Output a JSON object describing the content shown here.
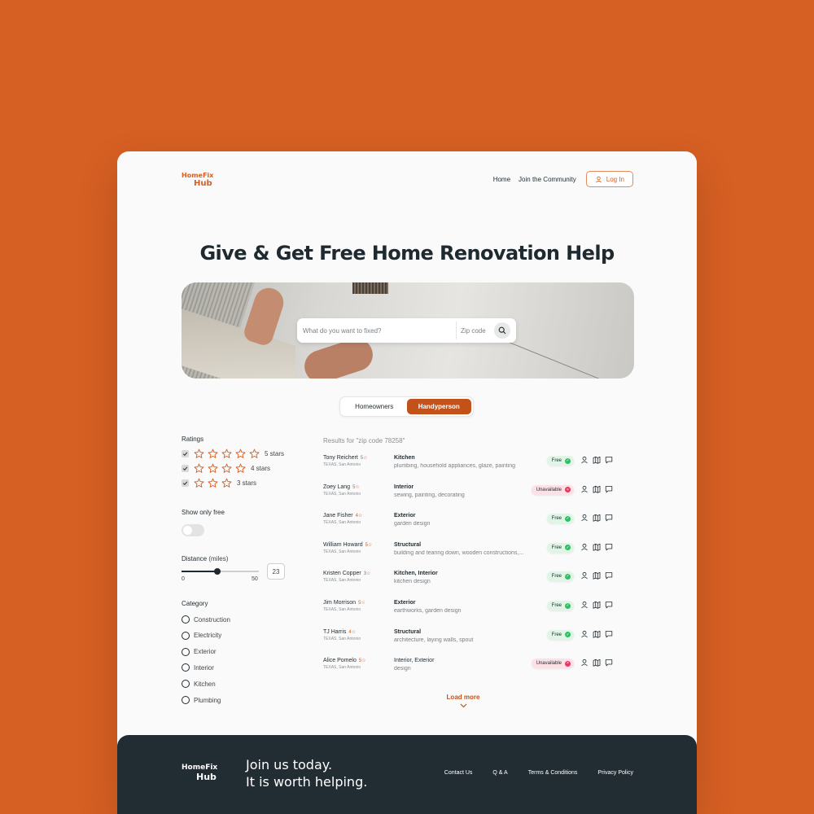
{
  "logo": {
    "line1": "HomeFix",
    "line2": "Hub"
  },
  "nav": {
    "home": "Home",
    "community": "Join the Community",
    "login": "Log In"
  },
  "hero": {
    "title": "Give & Get Free Home Renovation Help",
    "search_placeholder": "What do you want to fixed?",
    "zip_placeholder": "Zip code"
  },
  "tabs": {
    "homeowners": "Homeowners",
    "handyperson": "Handyperson",
    "active": "Handyperson"
  },
  "filters": {
    "ratings_title": "Ratings",
    "ratings": [
      {
        "label": "5 stars",
        "stars": 5,
        "checked": true
      },
      {
        "label": "4 stars",
        "stars": 4,
        "checked": true
      },
      {
        "label": "3 stars",
        "stars": 3,
        "checked": true
      }
    ],
    "free_title": "Show only free",
    "free_on": false,
    "distance_title": "Distance",
    "distance_unit": "(miles)",
    "distance_min": "0",
    "distance_max": "50",
    "distance_value": "23",
    "category_title": "Category",
    "categories": [
      "Construction",
      "Electricity",
      "Exterior",
      "Interior",
      "Kitchen",
      "Plumbing"
    ]
  },
  "results": {
    "heading": "Results for \"zip code 78258\"",
    "rows": [
      {
        "name": "Tony Reichert",
        "rating": "5☆",
        "location": "TEXAS, San Antonio",
        "category": "Kitchen",
        "desc": "plumbing, household appliances, glaze, painting",
        "status": "Free"
      },
      {
        "name": "Zoey Lang",
        "rating": "5☆",
        "location": "TEXAS, San Antonio",
        "category": "Interior",
        "desc": "sewing, painting, decorating",
        "status": "Unavailable"
      },
      {
        "name": "Jane Fisher",
        "rating": "4☆",
        "location": "TEXAS, San Antonio",
        "category": "Exterior",
        "desc": "garden design",
        "status": "Free"
      },
      {
        "name": "William Howard",
        "rating": "5☆",
        "location": "TEXAS, San Antonio",
        "category": "Structural",
        "desc": "building and tearing down, wooden constructions,...",
        "status": "Free"
      },
      {
        "name": "Kristen Copper",
        "rating": "3☆",
        "location": "TEXAS, San Antonio",
        "category": "Kitchen, Interior",
        "desc": "kitchen design",
        "status": "Free"
      },
      {
        "name": "Jim Morrison",
        "rating": "5☆",
        "location": "TEXAS, San Antonio",
        "category": "Exterior",
        "desc": "earthworks, garden design",
        "status": "Free"
      },
      {
        "name": "TJ Harris",
        "rating": "4☆",
        "location": "TEXAS, San Antonio",
        "category": "Structural",
        "desc": "architecture, laying walls, spout",
        "status": "Free"
      },
      {
        "name": "Alice Pomelo",
        "rating": "5☆",
        "location": "TEXAS, San Antonio",
        "category": "Interior, Exterior",
        "desc": "design",
        "status": "Unavailable"
      }
    ],
    "load_more": "Load more"
  },
  "footer": {
    "logo_line1": "HomeFix",
    "logo_line2": "Hub",
    "tagline1": "Join us today.",
    "tagline2": "It is worth helping.",
    "links": [
      "Contact Us",
      "Q & A",
      "Terms & Conditions",
      "Privacy Policy"
    ]
  },
  "colors": {
    "accent": "#d65f23",
    "dark": "#222c33",
    "free": "#2fbf62",
    "unavailable": "#e23a5f"
  }
}
